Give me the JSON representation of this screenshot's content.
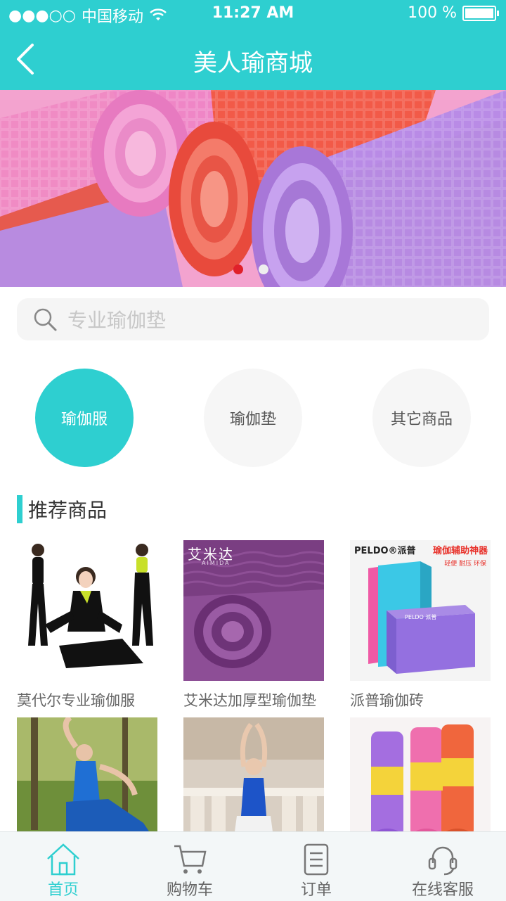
{
  "status_bar": {
    "signal": "●●●○○",
    "carrier": "中国移动",
    "time": "11:27 AM",
    "battery": "100 %"
  },
  "nav": {
    "title": "美人瑜商城",
    "back_icon": "chevron-left-icon"
  },
  "banner": {
    "slide_count": 2,
    "active_index": 0,
    "colors": {
      "active_dot": "#e0202a",
      "inactive_dot": "#eeeeee"
    }
  },
  "search": {
    "placeholder": "专业瑜伽垫",
    "value": ""
  },
  "categories": [
    {
      "label": "瑜伽服",
      "active": true
    },
    {
      "label": "瑜伽垫",
      "active": false
    },
    {
      "label": "其它商品",
      "active": false
    }
  ],
  "recommend": {
    "title": "推荐商品",
    "products": [
      {
        "name": "莫代尔专业瑜伽服",
        "brand_text": ""
      },
      {
        "name": "艾米达加厚型瑜伽垫",
        "brand_text": "艾米达",
        "brand_sub": "AIMIDA"
      },
      {
        "name": "派普瑜伽砖",
        "brand_text": "PELDO®派普",
        "promo": "瑜伽辅助神器",
        "promo_sub": "轻便 耐压 环保",
        "block_text": "PELDO 派普"
      },
      {
        "name": "",
        "brand_text": ""
      },
      {
        "name": "",
        "brand_text": ""
      },
      {
        "name": "",
        "brand_text": ""
      }
    ]
  },
  "tabbar": {
    "tabs": [
      {
        "label": "首页",
        "icon": "home-icon",
        "active": true
      },
      {
        "label": "购物车",
        "icon": "cart-icon",
        "active": false
      },
      {
        "label": "订单",
        "icon": "order-icon",
        "active": false
      },
      {
        "label": "在线客服",
        "icon": "headset-icon",
        "active": false
      }
    ]
  },
  "colors": {
    "accent": "#2ecfd0",
    "text_primary": "#333333",
    "text_secondary": "#666666"
  }
}
